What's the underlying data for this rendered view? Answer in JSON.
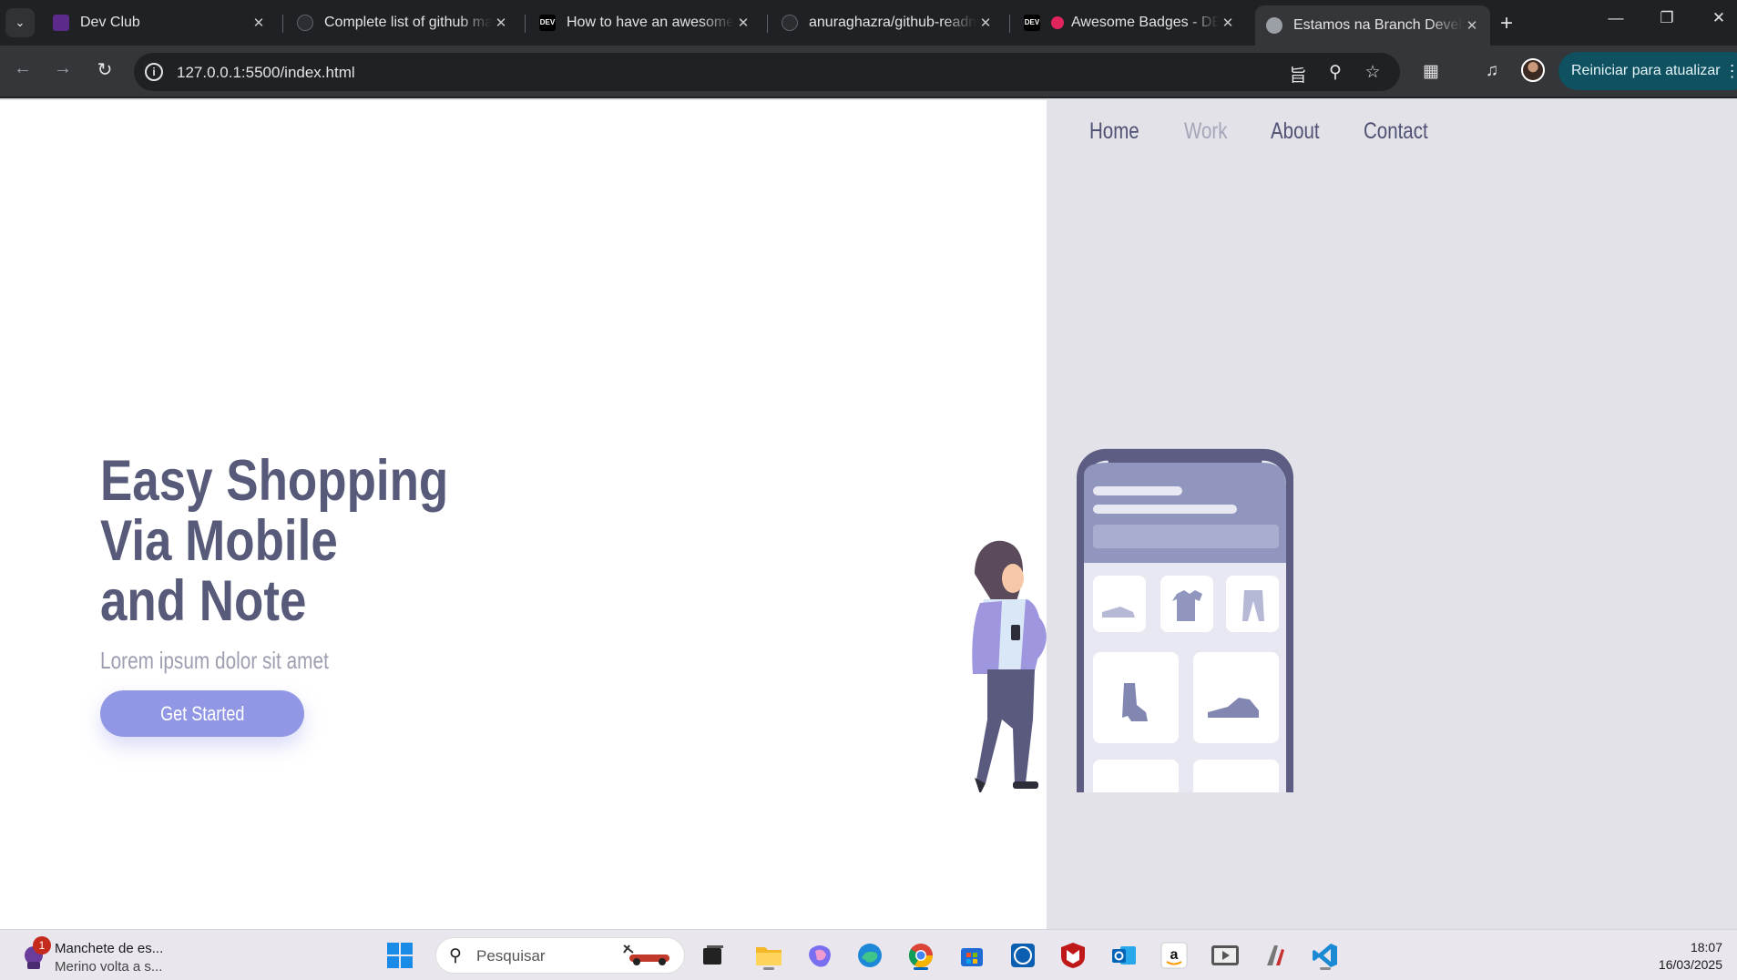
{
  "browser": {
    "tabs": [
      {
        "title": "Dev Club",
        "favicon_color": "#5b2a8a"
      },
      {
        "title": "Complete list of github markdown emoji",
        "favicon_color": "#2b2d31"
      },
      {
        "title": "How to have an awesome GitHub profile",
        "favicon_color": "#000000"
      },
      {
        "title": "anuraghazra/github-readme-stats",
        "favicon_color": "#2b2d31"
      },
      {
        "title": "Awesome Badges - DEV",
        "favicon_color": "#000000"
      },
      {
        "title": "Estamos na Branch Develop",
        "favicon_color": "#9aa0a6",
        "active": true
      }
    ],
    "url": "127.0.0.1:5500/index.html",
    "update_button": "Reiniciar para atualizar"
  },
  "site": {
    "nav": [
      {
        "label": "Home"
      },
      {
        "label": "Work"
      },
      {
        "label": "About"
      },
      {
        "label": "Contact"
      }
    ],
    "hero": {
      "line1": "Easy Shopping",
      "line2": "Via Mobile",
      "line3": "and Note",
      "subtitle": "Lorem ipsum dolor sit amet",
      "cta": "Get Started"
    },
    "colors": {
      "accent": "#9197e5",
      "heading": "#575a79",
      "panel": "#e2e2e8"
    }
  },
  "taskbar": {
    "news_title": "Manchete de es...",
    "news_sub": "Merino volta a s...",
    "news_badge": "1",
    "search_placeholder": "Pesquisar",
    "time": "18:07",
    "date": "16/03/2025"
  }
}
